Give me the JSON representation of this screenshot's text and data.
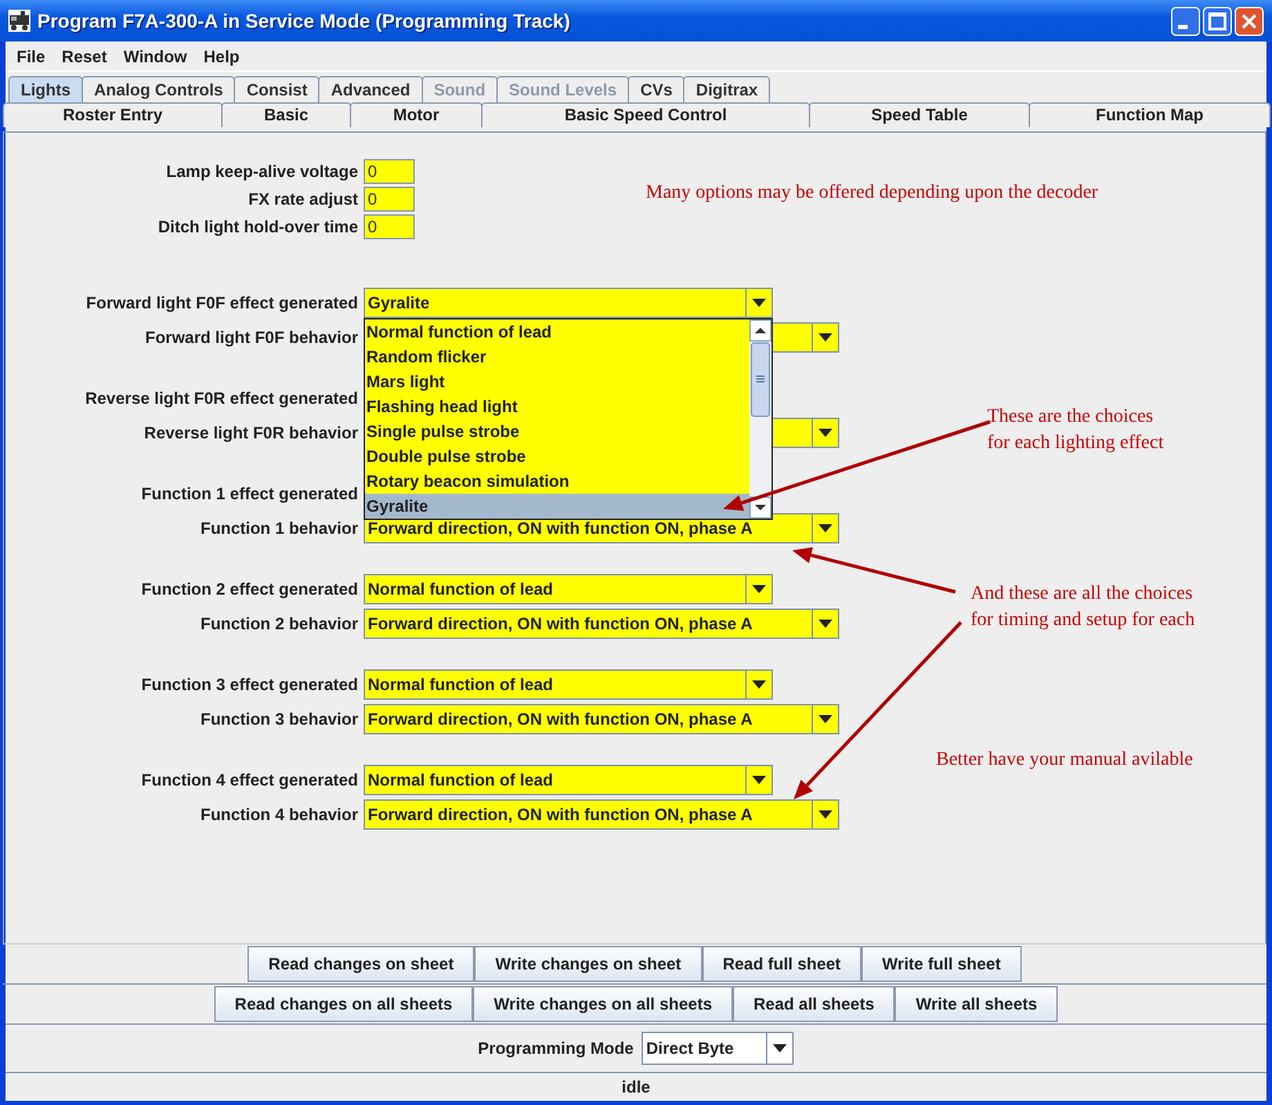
{
  "window": {
    "title": "Program F7A-300-A in Service Mode (Programming Track)"
  },
  "menu": [
    "File",
    "Reset",
    "Window",
    "Help"
  ],
  "tabs_row1": [
    {
      "label": "Lights",
      "selected": true,
      "disabled": false
    },
    {
      "label": "Analog Controls",
      "selected": false,
      "disabled": false
    },
    {
      "label": "Consist",
      "selected": false,
      "disabled": false
    },
    {
      "label": "Advanced",
      "selected": false,
      "disabled": false
    },
    {
      "label": "Sound",
      "selected": false,
      "disabled": true
    },
    {
      "label": "Sound Levels",
      "selected": false,
      "disabled": true
    },
    {
      "label": "CVs",
      "selected": false,
      "disabled": false
    },
    {
      "label": "Digitrax",
      "selected": false,
      "disabled": false
    }
  ],
  "tabs_row2": [
    {
      "label": "Roster Entry",
      "selected": false
    },
    {
      "label": "Basic",
      "selected": false
    },
    {
      "label": "Motor",
      "selected": false
    },
    {
      "label": "Basic Speed Control",
      "selected": false
    },
    {
      "label": "Speed Table",
      "selected": false
    },
    {
      "label": "Function Map",
      "selected": false
    }
  ],
  "groups": [
    [
      {
        "kind": "number",
        "label": "Lamp keep-alive voltage",
        "value": "0"
      },
      {
        "kind": "number",
        "label": "FX rate adjust",
        "value": "0"
      },
      {
        "kind": "number",
        "label": "Ditch light hold-over time",
        "value": "0"
      }
    ],
    [
      {
        "kind": "effect",
        "label": "Forward light F0F effect generated",
        "value": "Gyralite",
        "dropdown": [
          {
            "label": "Normal function of lead",
            "selected": false
          },
          {
            "label": "Random flicker",
            "selected": false
          },
          {
            "label": "Mars light",
            "selected": false
          },
          {
            "label": "Flashing head light",
            "selected": false
          },
          {
            "label": "Single pulse strobe",
            "selected": false
          },
          {
            "label": "Double pulse strobe",
            "selected": false
          },
          {
            "label": "Rotary beacon simulation",
            "selected": false
          },
          {
            "label": "Gyralite",
            "selected": true
          }
        ]
      },
      {
        "kind": "behavior",
        "label": "Forward light F0F behavior"
      }
    ],
    [
      {
        "kind": "effect",
        "label": "Reverse light F0R effect generated"
      },
      {
        "kind": "behavior",
        "label": "Reverse light F0R behavior"
      }
    ],
    [
      {
        "kind": "effect",
        "label": "Function 1 effect generated"
      },
      {
        "kind": "behavior",
        "label": "Function 1 behavior",
        "value": "Forward direction, ON with function ON, phase A"
      }
    ],
    [
      {
        "kind": "effect",
        "label": "Function 2 effect generated",
        "value": "Normal function of lead"
      },
      {
        "kind": "behavior",
        "label": "Function 2 behavior",
        "value": "Forward direction, ON with function ON, phase A"
      }
    ],
    [
      {
        "kind": "effect",
        "label": "Function 3 effect generated",
        "value": "Normal function of lead"
      },
      {
        "kind": "behavior",
        "label": "Function 3 behavior",
        "value": "Forward direction, ON with function ON, phase A"
      }
    ],
    [
      {
        "kind": "effect",
        "label": "Function 4 effect generated",
        "value": "Normal function of lead"
      },
      {
        "kind": "behavior",
        "label": "Function 4 behavior",
        "value": "Forward direction, ON with function ON, phase A"
      }
    ]
  ],
  "annotations": [
    {
      "lines": [
        "Many options may be offered depending upon the decoder"
      ]
    },
    {
      "lines": [
        "These are the choices",
        "for each lighting effect"
      ]
    },
    {
      "lines": [
        "And these are all the choices",
        "for timing and setup for each"
      ]
    },
    {
      "lines": [
        "Better have your manual avilable"
      ]
    }
  ],
  "sheet_buttons": [
    "Read changes on sheet",
    "Write changes on sheet",
    "Read full sheet",
    "Write full sheet"
  ],
  "all_buttons": [
    "Read changes on all sheets",
    "Write changes on all sheets",
    "Read all sheets",
    "Write all sheets"
  ],
  "programming_mode": {
    "label": "Programming Mode",
    "value": "Direct Byte"
  },
  "status_bar": "idle"
}
